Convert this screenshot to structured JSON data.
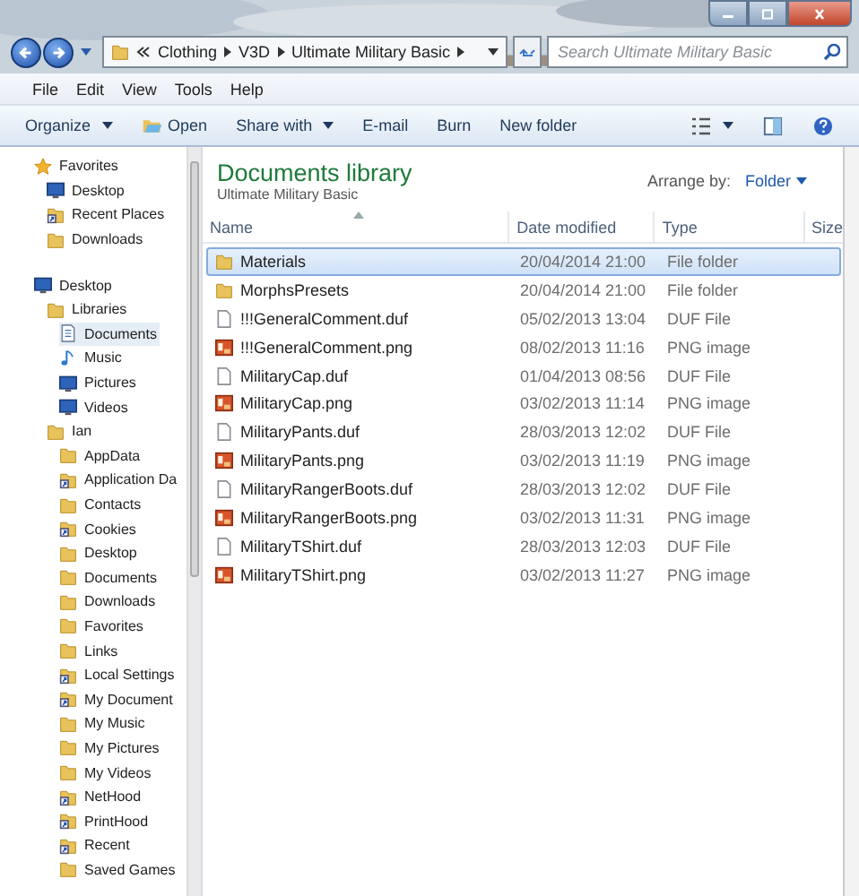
{
  "address": {
    "crumbs": [
      "Clothing",
      "V3D",
      "Ultimate Military Basic"
    ]
  },
  "search": {
    "placeholder": "Search Ultimate Military Basic"
  },
  "menu": [
    "File",
    "Edit",
    "View",
    "Tools",
    "Help"
  ],
  "commands": [
    {
      "label": "Organize",
      "dropdown": true,
      "icon": false
    },
    {
      "label": "Open",
      "dropdown": false,
      "icon": true
    },
    {
      "label": "Share with",
      "dropdown": true,
      "icon": false
    },
    {
      "label": "E-mail",
      "dropdown": false,
      "icon": false
    },
    {
      "label": "Burn",
      "dropdown": false,
      "icon": false
    },
    {
      "label": "New folder",
      "dropdown": false,
      "icon": false
    }
  ],
  "navigation": {
    "favorites": {
      "label": "Favorites",
      "items": [
        {
          "label": "Desktop",
          "kind": "screen",
          "selected": false
        },
        {
          "label": "Recent Places",
          "kind": "shortcut",
          "selected": false
        },
        {
          "label": "Downloads",
          "kind": "folder",
          "selected": false
        }
      ]
    },
    "tree": [
      {
        "label": "Desktop",
        "kind": "screen",
        "selected": false,
        "children": [
          {
            "label": "Libraries",
            "kind": "folder",
            "selected": false,
            "children": [
              {
                "label": "Documents",
                "kind": "doc",
                "selected": true
              },
              {
                "label": "Music",
                "kind": "music",
                "selected": false
              },
              {
                "label": "Pictures",
                "kind": "screen",
                "selected": false
              },
              {
                "label": "Videos",
                "kind": "screen",
                "selected": false
              }
            ]
          },
          {
            "label": "Ian",
            "kind": "folder",
            "selected": false,
            "children": [
              {
                "label": "AppData",
                "kind": "folder",
                "selected": false
              },
              {
                "label": "Application Da",
                "kind": "shortcut",
                "selected": false
              },
              {
                "label": "Contacts",
                "kind": "folder",
                "selected": false
              },
              {
                "label": "Cookies",
                "kind": "shortcut",
                "selected": false
              },
              {
                "label": "Desktop",
                "kind": "folder",
                "selected": false
              },
              {
                "label": "Documents",
                "kind": "folder",
                "selected": false
              },
              {
                "label": "Downloads",
                "kind": "folder",
                "selected": false
              },
              {
                "label": "Favorites",
                "kind": "folder",
                "selected": false
              },
              {
                "label": "Links",
                "kind": "folder",
                "selected": false
              },
              {
                "label": "Local Settings",
                "kind": "shortcut",
                "selected": false
              },
              {
                "label": "My Document",
                "kind": "shortcut",
                "selected": false
              },
              {
                "label": "My Music",
                "kind": "folder",
                "selected": false
              },
              {
                "label": "My Pictures",
                "kind": "folder",
                "selected": false
              },
              {
                "label": "My Videos",
                "kind": "folder",
                "selected": false
              },
              {
                "label": "NetHood",
                "kind": "shortcut",
                "selected": false
              },
              {
                "label": "PrintHood",
                "kind": "shortcut",
                "selected": false
              },
              {
                "label": "Recent",
                "kind": "shortcut",
                "selected": false
              },
              {
                "label": "Saved Games",
                "kind": "folder",
                "selected": false
              }
            ]
          }
        ]
      }
    ]
  },
  "library": {
    "title": "Documents library",
    "subtitle": "Ultimate Military Basic",
    "arrange_label": "Arrange by:",
    "arrange_value": "Folder"
  },
  "columns": [
    "Name",
    "Date modified",
    "Type",
    "Size"
  ],
  "files": [
    {
      "name": "Materials",
      "date": "20/04/2014 21:00",
      "type": "File folder",
      "kind": "folder",
      "selected": true
    },
    {
      "name": "MorphsPresets",
      "date": "20/04/2014 21:00",
      "type": "File folder",
      "kind": "folder",
      "selected": false
    },
    {
      "name": "!!!GeneralComment.duf",
      "date": "05/02/2013 13:04",
      "type": "DUF File",
      "kind": "duf",
      "selected": false
    },
    {
      "name": "!!!GeneralComment.png",
      "date": "08/02/2013 11:16",
      "type": "PNG image",
      "kind": "png",
      "selected": false
    },
    {
      "name": "MilitaryCap.duf",
      "date": "01/04/2013 08:56",
      "type": "DUF File",
      "kind": "duf",
      "selected": false
    },
    {
      "name": "MilitaryCap.png",
      "date": "03/02/2013 11:14",
      "type": "PNG image",
      "kind": "png",
      "selected": false
    },
    {
      "name": "MilitaryPants.duf",
      "date": "28/03/2013 12:02",
      "type": "DUF File",
      "kind": "duf",
      "selected": false
    },
    {
      "name": "MilitaryPants.png",
      "date": "03/02/2013 11:19",
      "type": "PNG image",
      "kind": "png",
      "selected": false
    },
    {
      "name": "MilitaryRangerBoots.duf",
      "date": "28/03/2013 12:02",
      "type": "DUF File",
      "kind": "duf",
      "selected": false
    },
    {
      "name": "MilitaryRangerBoots.png",
      "date": "03/02/2013 11:31",
      "type": "PNG image",
      "kind": "png",
      "selected": false
    },
    {
      "name": "MilitaryTShirt.duf",
      "date": "28/03/2013 12:03",
      "type": "DUF File",
      "kind": "duf",
      "selected": false
    },
    {
      "name": "MilitaryTShirt.png",
      "date": "03/02/2013 11:27",
      "type": "PNG image",
      "kind": "png",
      "selected": false
    }
  ]
}
